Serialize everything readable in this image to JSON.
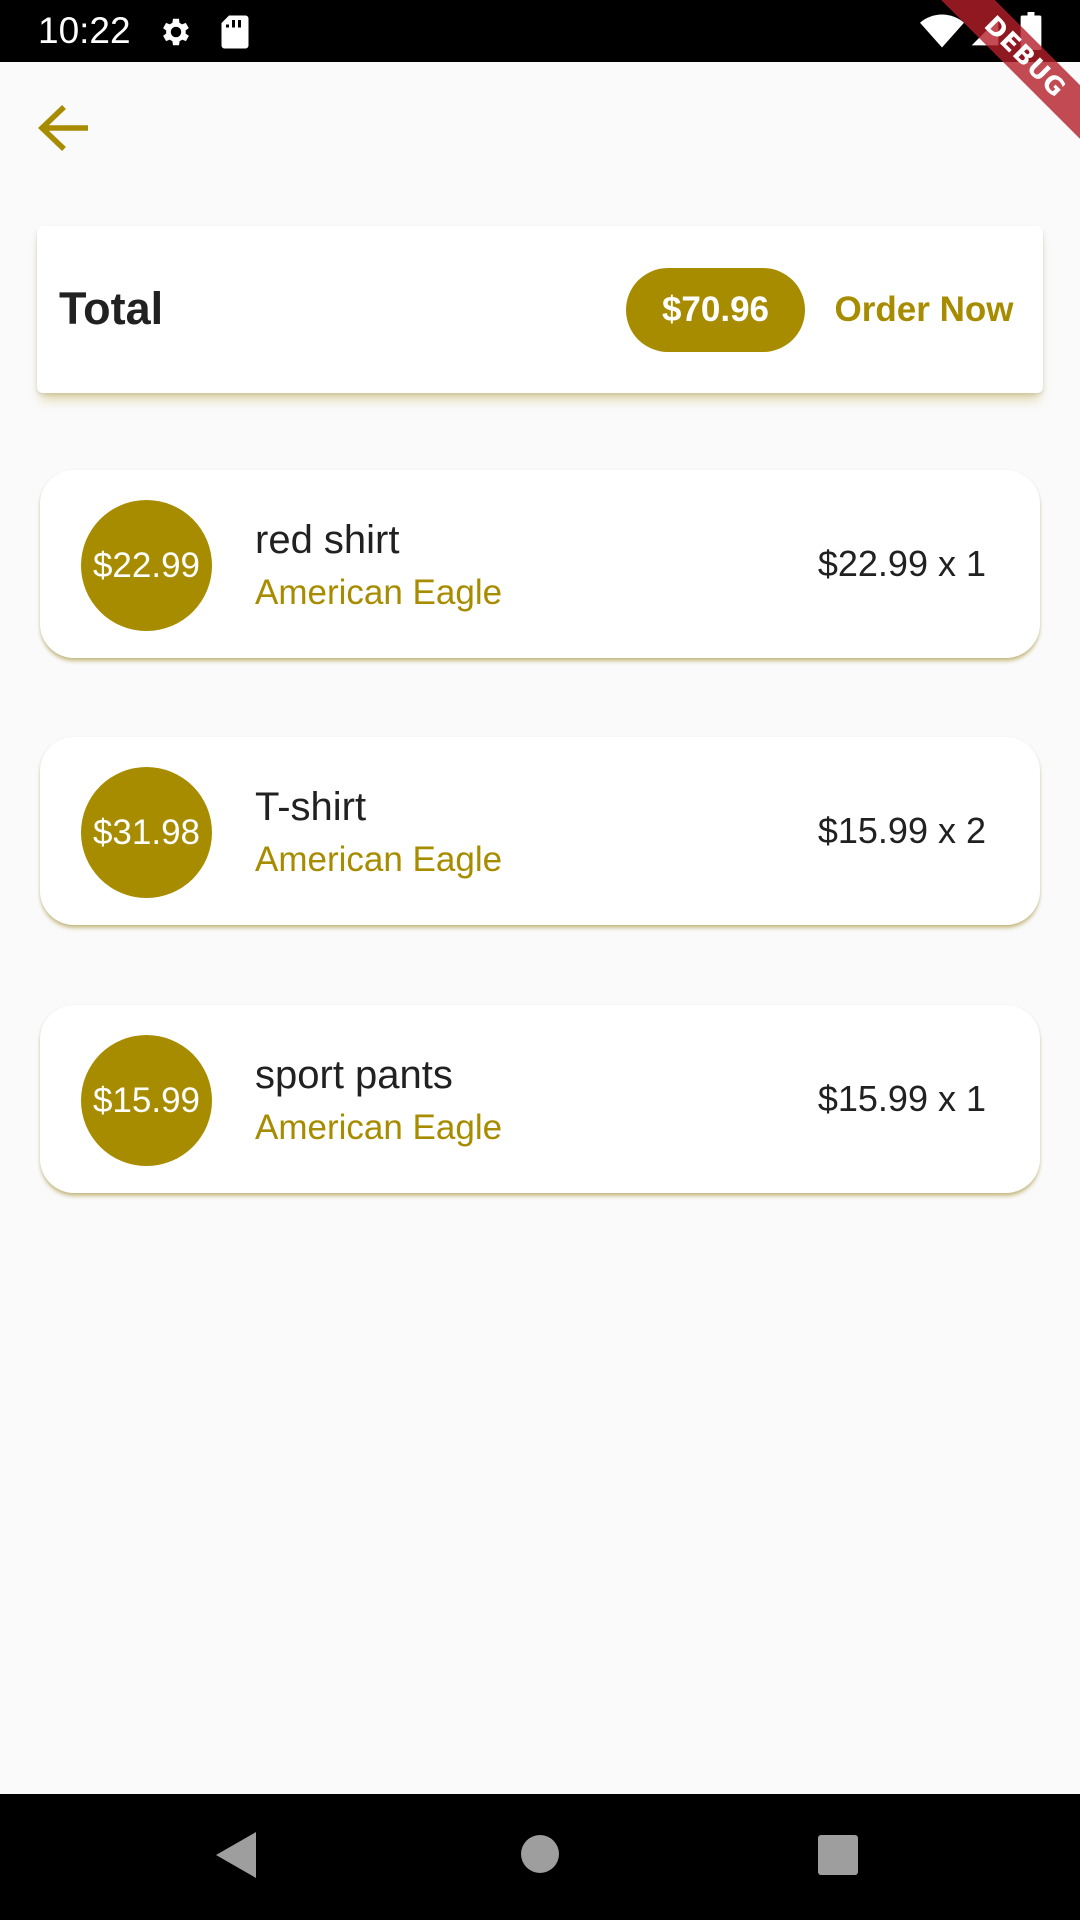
{
  "status_bar": {
    "time": "10:22"
  },
  "debug_banner": {
    "label": "DEBUG"
  },
  "header": {
    "back_icon": "arrow-back-icon"
  },
  "total_card": {
    "label": "Total",
    "amount": "$70.96",
    "order_button_label": "Order Now"
  },
  "cart_items": [
    {
      "price_badge": "$22.99",
      "name": "red shirt",
      "brand": "American Eagle",
      "quantity_text": "$22.99 x 1"
    },
    {
      "price_badge": "$31.98",
      "name": "T-shirt",
      "brand": "American Eagle",
      "quantity_text": "$15.99 x 2"
    },
    {
      "price_badge": "$15.99",
      "name": "sport pants",
      "brand": "American Eagle",
      "quantity_text": "$15.99 x 1"
    }
  ],
  "nav_bar": {
    "back_icon": "nav-back-icon",
    "home_icon": "nav-home-icon",
    "recents_icon": "nav-recents-icon"
  },
  "colors": {
    "accent": "#a88c00",
    "background": "#fafafa",
    "card": "#ffffff",
    "text": "#212121"
  }
}
